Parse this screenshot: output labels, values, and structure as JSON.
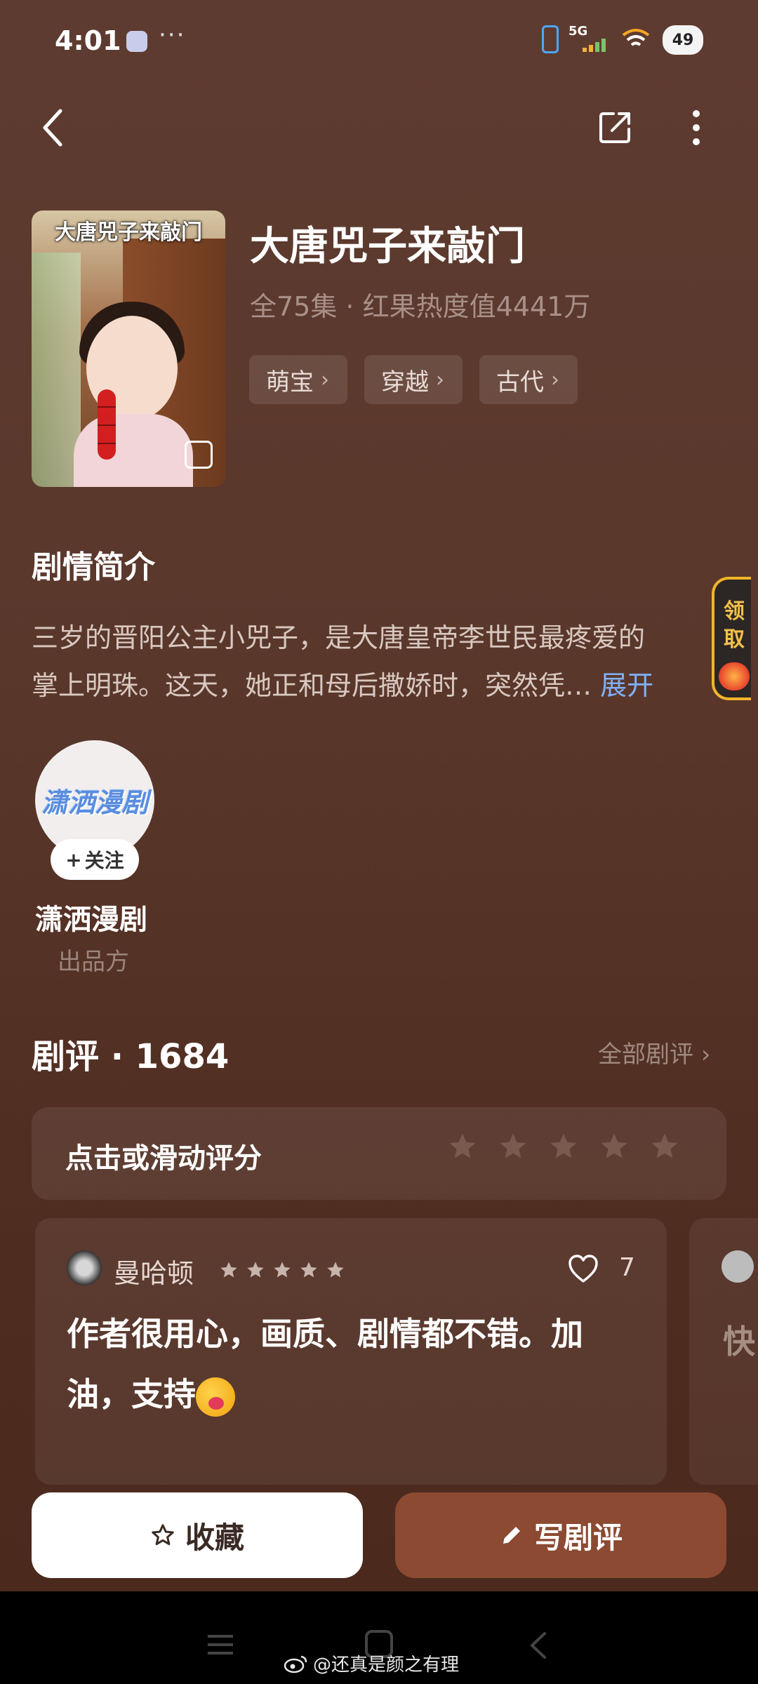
{
  "status_bar": {
    "time": "4:01",
    "dots": "···",
    "network": "5G",
    "battery": "49"
  },
  "drama": {
    "cover_title": "大唐兕子来敲门",
    "title": "大唐兕子来敲门",
    "meta": "全75集 · 红果热度值4441万",
    "tags": [
      "萌宝",
      "穿越",
      "古代"
    ]
  },
  "synopsis": {
    "heading": "剧情简介",
    "line1": "三岁的晋阳公主小兕子，是大唐皇帝李世民最疼爱的",
    "line2": "掌上明珠。这天，她正和母后撒娇时，突然凭…",
    "expand": "展开"
  },
  "claim_widget": {
    "label": "领取"
  },
  "producer": {
    "logo_text": "潇洒漫剧",
    "follow": "关注",
    "follow_plus": "+",
    "name": "潇洒漫剧",
    "role": "出品方"
  },
  "reviews": {
    "heading": "剧评 · 1684",
    "all_link": "全部剧评",
    "rate_prompt": "点击或滑动评分",
    "items": [
      {
        "user": "曼哈顿",
        "stars": 5,
        "likes": "7",
        "body": "作者很用心，画质、剧情都不错。加油，支持"
      },
      {
        "partial_text": "快"
      }
    ]
  },
  "actions": {
    "favorite": "收藏",
    "write_review": "写剧评"
  },
  "watermark": "@还真是颜之有理",
  "colors": {
    "accent_blue": "#7fb2ff",
    "write_button": "#8c4a32",
    "claim_gold": "#f0b42a"
  }
}
